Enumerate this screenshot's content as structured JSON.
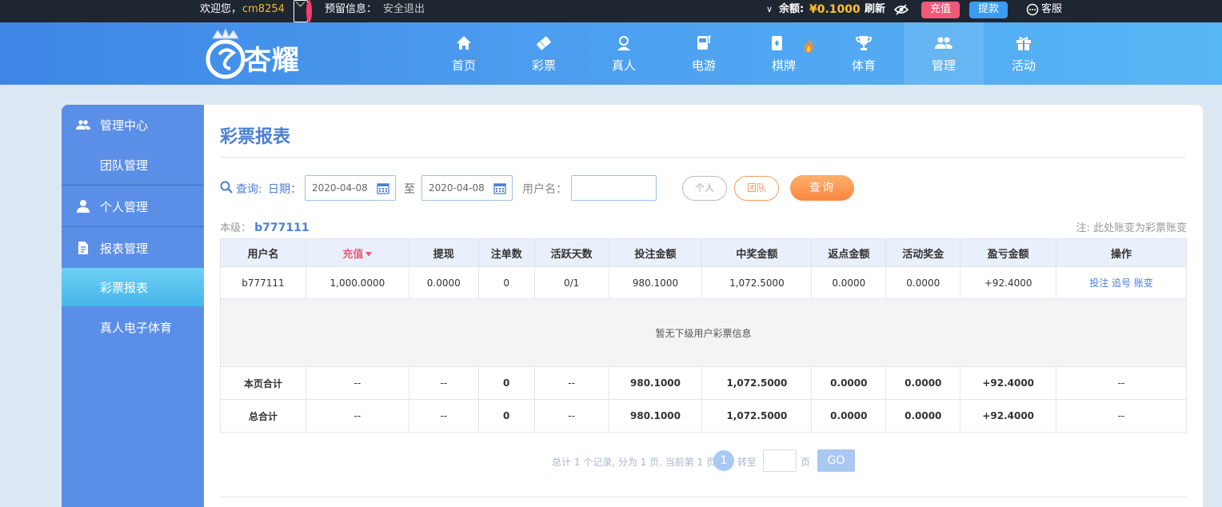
{
  "topbar": {
    "welcome": "欢迎您，",
    "username": "cm8254",
    "reserve_label": "预留信息：",
    "logout": "安全退出",
    "balance_label": "余额:",
    "balance_value": "¥0.1000",
    "refresh": "刷新",
    "recharge": "充值",
    "withdraw": "提款",
    "service": "客服"
  },
  "header": {
    "logo_text": "杏耀",
    "nav": [
      {
        "label": "首页",
        "icon": "home-icon"
      },
      {
        "label": "彩票",
        "icon": "ticket-icon"
      },
      {
        "label": "真人",
        "icon": "dealer-icon"
      },
      {
        "label": "电游",
        "icon": "slot-icon"
      },
      {
        "label": "棋牌",
        "icon": "cards-icon"
      },
      {
        "label": "体育",
        "icon": "trophy-icon"
      },
      {
        "label": "管理",
        "icon": "users-icon"
      },
      {
        "label": "活动",
        "icon": "gift-icon"
      }
    ],
    "active_nav": "管理"
  },
  "sidebar": {
    "group_mgmt": "管理中心",
    "team_mgmt": "团队管理",
    "personal_mgmt": "个人管理",
    "report_mgmt": "报表管理",
    "lottery_report": "彩票报表",
    "live_report": "真人电子体育"
  },
  "main": {
    "title": "彩票报表",
    "search": {
      "query_label": "查询:",
      "date_label": "日期：",
      "date_from": "2020-04-08",
      "to_label": "至",
      "date_to": "2020-04-08",
      "username_label": "用户名：",
      "username_value": "",
      "personal_btn": "个人",
      "team_btn": "团队",
      "query_btn": "查询"
    },
    "level_label": "本级：",
    "level_name": "b777111",
    "note": "注: 此处账变为彩票账变",
    "columns": [
      "用户名",
      "充值",
      "提现",
      "注单数",
      "活跃天数",
      "投注金额",
      "中奖金额",
      "返点金额",
      "活动奖金",
      "盈亏金额",
      "操作"
    ],
    "row": {
      "user": "b777111",
      "recharge": "1,000.0000",
      "withdraw": "0.0000",
      "orders": "0",
      "active_days": "0/1",
      "bet": "980.1000",
      "win": "1,072.5000",
      "rebate": "0.0000",
      "bonus": "0.0000",
      "profit": "+92.4000",
      "actions": [
        "投注",
        "追号",
        "账变"
      ]
    },
    "empty_text": "暂无下级用户彩票信息",
    "page_total": {
      "label": "本页合计",
      "recharge": "--",
      "withdraw": "--",
      "orders": "0",
      "active_days": "--",
      "bet": "980.1000",
      "win": "1,072.5000",
      "rebate": "0.0000",
      "bonus": "0.0000",
      "profit": "+92.4000",
      "actions": "--"
    },
    "grand_total": {
      "label": "总合计",
      "recharge": "--",
      "withdraw": "--",
      "orders": "0",
      "active_days": "--",
      "bet": "980.1000",
      "win": "1,072.5000",
      "rebate": "0.0000",
      "bonus": "0.0000",
      "profit": "+92.4000",
      "actions": "--"
    },
    "pager": {
      "summary": "总计 1 个记录, 分为 1 页, 当前第 1 页",
      "current": "1",
      "jump_label": "转至",
      "page_label": "页",
      "go": "GO"
    }
  },
  "colors": {
    "accent": "#4a7fd6",
    "header_start": "#3e85e5",
    "header_end": "#57b6f5",
    "sidebar": "#5b8ee6",
    "recharge_btn": "#ef5a79",
    "withdraw_btn": "#3b9df0",
    "query_btn": "#f78642",
    "profit_positive": "#1f8a1f"
  }
}
